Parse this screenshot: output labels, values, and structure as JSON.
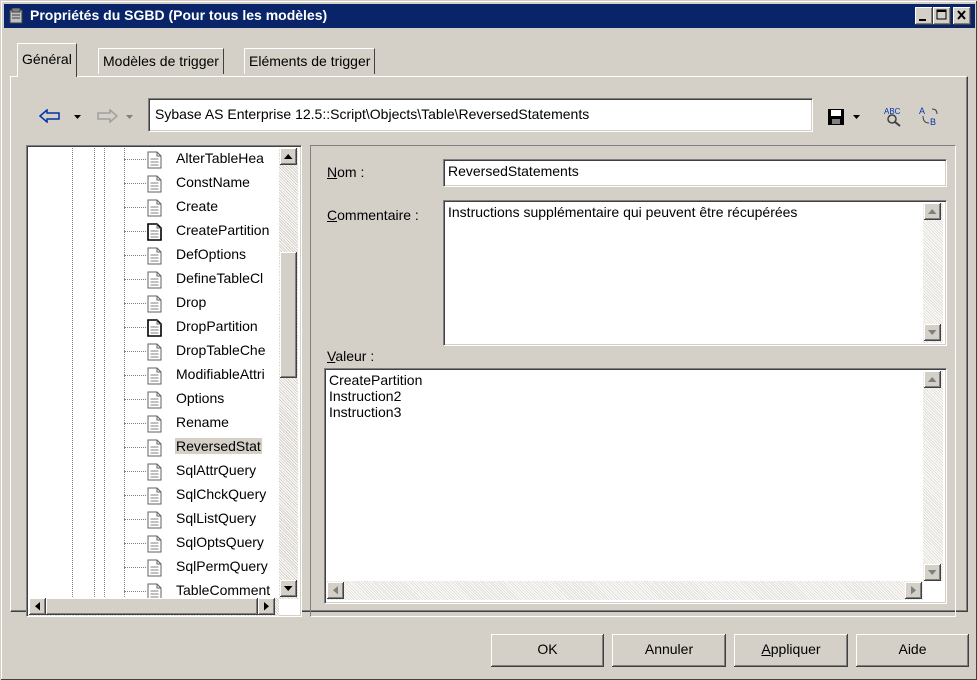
{
  "window": {
    "title": "Propriétés du SGBD (Pour tous les modèles)"
  },
  "tabs": [
    {
      "label": "Général",
      "active": true
    },
    {
      "label": "Modèles de trigger",
      "active": false
    },
    {
      "label": "Eléments de trigger",
      "active": false
    }
  ],
  "toolbar": {
    "path": "Sybase AS Enterprise 12.5::Script\\Objects\\Table\\ReversedStatements"
  },
  "tree": {
    "items": [
      {
        "label": "AlterTableHea",
        "icon": "document-icon"
      },
      {
        "label": "ConstName",
        "icon": "document-icon"
      },
      {
        "label": "Create",
        "icon": "document-icon"
      },
      {
        "label": "CreatePartition",
        "icon": "document-bold-icon"
      },
      {
        "label": "DefOptions",
        "icon": "document-icon"
      },
      {
        "label": "DefineTableCl",
        "icon": "document-icon"
      },
      {
        "label": "Drop",
        "icon": "document-icon"
      },
      {
        "label": "DropPartition",
        "icon": "document-bold-icon"
      },
      {
        "label": "DropTableChe",
        "icon": "document-icon"
      },
      {
        "label": "ModifiableAttri",
        "icon": "document-icon"
      },
      {
        "label": "Options",
        "icon": "document-icon"
      },
      {
        "label": "Rename",
        "icon": "document-icon"
      },
      {
        "label": "ReversedStat",
        "icon": "document-icon",
        "selected": true
      },
      {
        "label": "SqlAttrQuery",
        "icon": "document-icon"
      },
      {
        "label": "SqlChckQuery",
        "icon": "document-icon"
      },
      {
        "label": "SqlListQuery",
        "icon": "document-icon"
      },
      {
        "label": "SqlOptsQuery",
        "icon": "document-icon"
      },
      {
        "label": "SqlPermQuery",
        "icon": "document-icon"
      },
      {
        "label": "TableComment",
        "icon": "document-icon"
      }
    ]
  },
  "form": {
    "nom_label": "Nom :",
    "nom_value": "ReversedStatements",
    "commentaire_label": "Commentaire :",
    "commentaire_value": "Instructions supplémentaire qui peuvent être récupérées",
    "valeur_label": "Valeur :",
    "valeur_lines": [
      "CreatePartition",
      "Instruction2",
      "Instruction3"
    ]
  },
  "buttons": {
    "ok": "OK",
    "cancel": "Annuler",
    "apply": "Appliquer",
    "help": "Aide"
  },
  "colors": {
    "titlebar": "#0a246a",
    "face": "#d4d0c8"
  }
}
